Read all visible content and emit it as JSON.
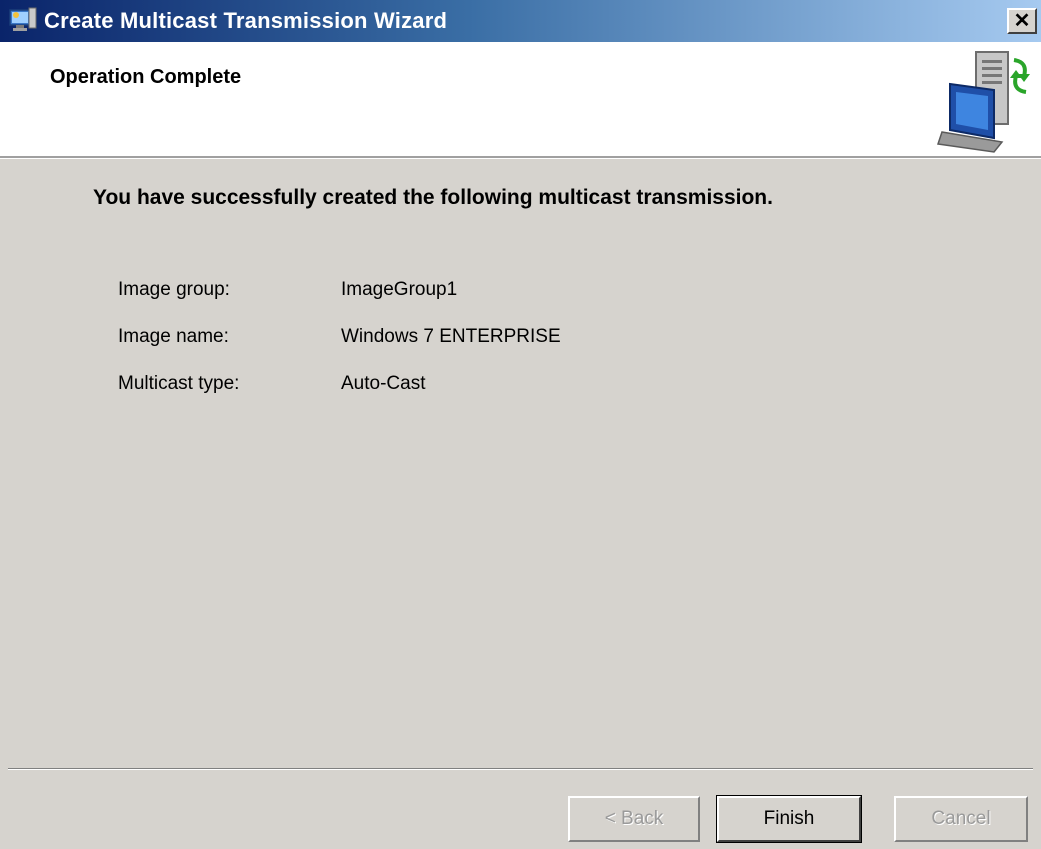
{
  "window": {
    "title": "Create Multicast Transmission Wizard",
    "close_label": "✕"
  },
  "header": {
    "title": "Operation Complete"
  },
  "body": {
    "message": "You have successfully created the following multicast transmission.",
    "details": [
      {
        "label": "Image group:",
        "value": "ImageGroup1"
      },
      {
        "label": "Image name:",
        "value": "Windows 7 ENTERPRISE"
      },
      {
        "label": "Multicast type:",
        "value": "Auto-Cast"
      }
    ]
  },
  "buttons": {
    "back": "< Back",
    "finish": "Finish",
    "cancel": "Cancel"
  },
  "icons": {
    "title": "wizard-app-icon",
    "header": "server-computer-icon",
    "close": "close-icon"
  },
  "colors": {
    "titlebar_start": "#0a246a",
    "titlebar_end": "#a6caf0",
    "dialog_bg": "#d6d3ce",
    "header_bg": "#ffffff"
  }
}
